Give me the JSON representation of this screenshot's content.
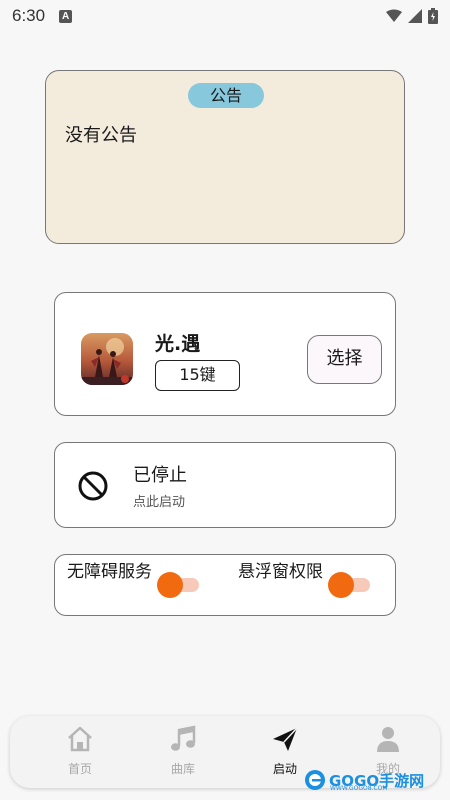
{
  "status_bar": {
    "time": "6:30",
    "badge": "A"
  },
  "notice": {
    "title": "公告",
    "text": "没有公告"
  },
  "game": {
    "name": "光.遇",
    "keys": "15键",
    "choose_label": "选择"
  },
  "service_status": {
    "title": "已停止",
    "subtitle": "点此启动"
  },
  "permissions": [
    {
      "label": "无障碍服务",
      "enabled": true
    },
    {
      "label": "悬浮窗权限",
      "enabled": true
    }
  ],
  "nav": {
    "items": [
      {
        "label": "首页",
        "icon": "home-icon",
        "active": false
      },
      {
        "label": "曲库",
        "icon": "music-note-icon",
        "active": false
      },
      {
        "label": "启动",
        "icon": "send-icon",
        "active": true
      },
      {
        "label": "我的",
        "icon": "person-icon",
        "active": false
      }
    ]
  },
  "watermark": {
    "text": "GOGO手游网",
    "sub": "WWW.GOGO8.COM"
  },
  "colors": {
    "accent": "#f26a10",
    "notice_bg": "#f3ecdc",
    "pill": "#87c8dc"
  }
}
